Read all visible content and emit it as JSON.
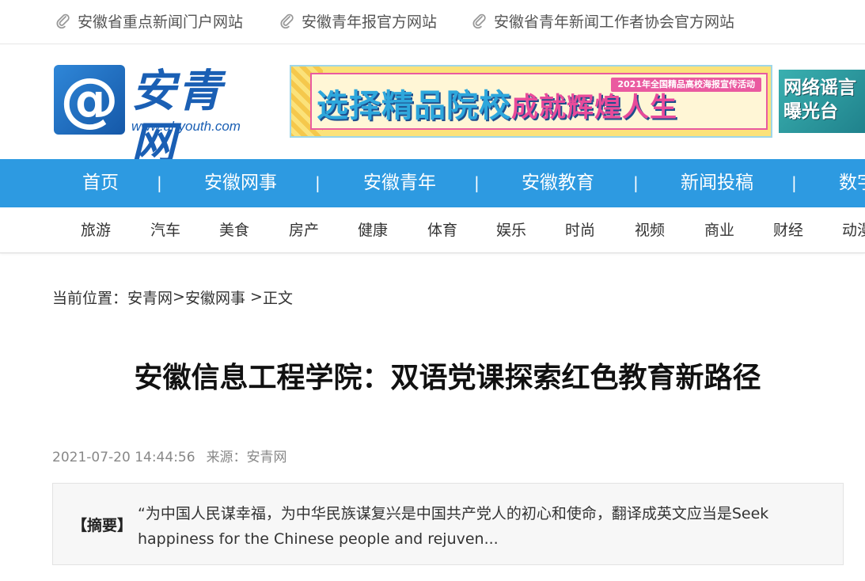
{
  "toplinks": [
    {
      "label": "安徽省重点新闻门户网站"
    },
    {
      "label": "安徽青年报官方网站"
    },
    {
      "label": "安徽省青年新闻工作者协会官方网站"
    }
  ],
  "header": {
    "logo_symbol": "@",
    "logo_name": "安青网",
    "logo_url": "www.ahyouth.com",
    "banner_tag": "2021年全国精品高校海报宣传活动",
    "banner_slogan_a": "选择精品院校",
    "banner_slogan_b": "成就辉煌人生",
    "rumor_label": "网络谣言曝光台"
  },
  "nav_primary": [
    "首页",
    "安徽网事",
    "安徽青年",
    "安徽教育",
    "新闻投稿",
    "数字"
  ],
  "nav_separator": "|",
  "nav_secondary": [
    "旅游",
    "汽车",
    "美食",
    "房产",
    "健康",
    "体育",
    "娱乐",
    "时尚",
    "视频",
    "商业",
    "财经",
    "动漫"
  ],
  "breadcrumb": {
    "prefix": "当前位置：",
    "items": [
      "安青网",
      "安徽网事",
      "正文"
    ],
    "sep1": ">",
    "sep2": " >"
  },
  "article": {
    "title": "安徽信息工程学院：双语党课探索红色教育新路径",
    "date": "2021-07-20 14:44:56",
    "source": "来源：安青网",
    "summary_label": "【摘要】",
    "summary_text": "“为中国人民谋幸福，为中华民族谋复兴是中国共产党人的初心和使命，翻译成英文应当是Seek happiness for the Chinese people and rejuven..."
  },
  "colors": {
    "nav_primary_bg": "#2d9ae1",
    "brand_blue": "#1a5fb4"
  }
}
